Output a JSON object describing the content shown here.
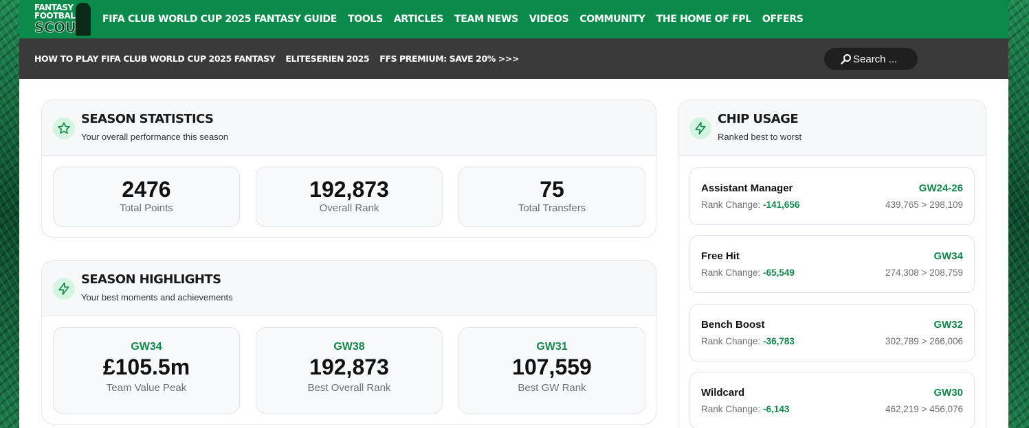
{
  "logo": {
    "line1": "FANTASY",
    "line2": "FOOTBALL",
    "line3": "SCOUT"
  },
  "topnav": {
    "items": [
      "FIFA CLUB WORLD CUP 2025 FANTASY GUIDE",
      "TOOLS",
      "ARTICLES",
      "TEAM NEWS",
      "VIDEOS",
      "COMMUNITY",
      "THE HOME OF FPL",
      "OFFERS"
    ]
  },
  "subnav": {
    "items": [
      "HOW TO PLAY FIFA CLUB WORLD CUP 2025 FANTASY",
      "ELITESERIEN 2025",
      "FFS PREMIUM: SAVE 20% >>>"
    ],
    "search_label": "Search ..."
  },
  "season_statistics": {
    "title": "SEASON STATISTICS",
    "subtitle": "Your overall performance this season",
    "icon": "star-icon",
    "stats": [
      {
        "value": "2476",
        "label": "Total Points"
      },
      {
        "value": "192,873",
        "label": "Overall Rank"
      },
      {
        "value": "75",
        "label": "Total Transfers"
      }
    ]
  },
  "season_highlights": {
    "title": "SEASON HIGHLIGHTS",
    "subtitle": "Your best moments and achievements",
    "icon": "lightning-icon",
    "items": [
      {
        "gw": "GW34",
        "value": "£105.5m",
        "label": "Team Value Peak"
      },
      {
        "gw": "GW38",
        "value": "192,873",
        "label": "Best Overall Rank"
      },
      {
        "gw": "GW31",
        "value": "107,559",
        "label": "Best GW Rank"
      }
    ]
  },
  "chip_usage": {
    "title": "CHIP USAGE",
    "subtitle": "Ranked best to worst",
    "icon": "lightning-icon",
    "rank_change_label": "Rank Change:",
    "chips": [
      {
        "name": "Assistant Manager",
        "gw": "GW24-26",
        "delta": "-141,656",
        "range": "439,765 > 298,109"
      },
      {
        "name": "Free Hit",
        "gw": "GW34",
        "delta": "-65,549",
        "range": "274,308 > 208,759"
      },
      {
        "name": "Bench Boost",
        "gw": "GW32",
        "delta": "-36,783",
        "range": "302,789 > 266,006"
      },
      {
        "name": "Wildcard",
        "gw": "GW30",
        "delta": "-6,143",
        "range": "462,219 > 456,076"
      }
    ]
  },
  "colors": {
    "brand_green": "#0b8a4c",
    "subnav_bg": "#3a3a3a",
    "accent_green": "#11884a",
    "icon_bg": "#d6f4e2"
  }
}
